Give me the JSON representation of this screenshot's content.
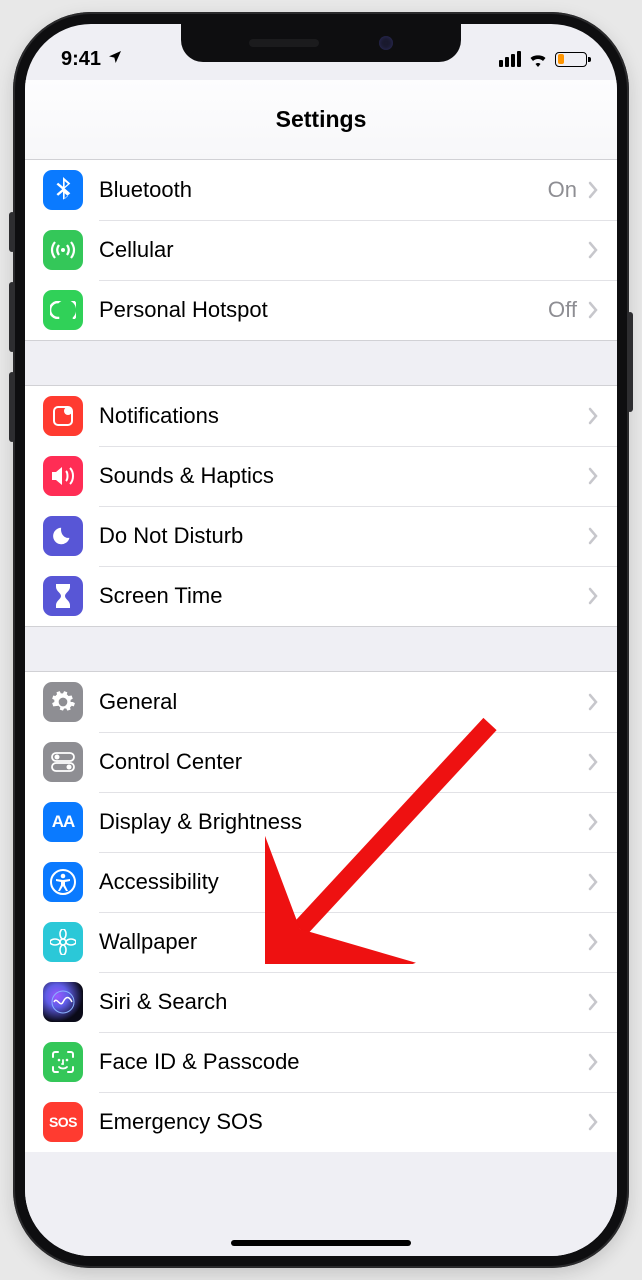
{
  "statusbar": {
    "time": "9:41"
  },
  "header": {
    "title": "Settings"
  },
  "groups": [
    {
      "rows": [
        {
          "name": "bluetooth",
          "label": "Bluetooth",
          "value": "On",
          "icon": "bluetooth-icon",
          "bg": "bg-blue"
        },
        {
          "name": "cellular",
          "label": "Cellular",
          "value": "",
          "icon": "cellular-icon",
          "bg": "bg-green"
        },
        {
          "name": "personal-hotspot",
          "label": "Personal Hotspot",
          "value": "Off",
          "icon": "hotspot-icon",
          "bg": "bg-green2"
        }
      ]
    },
    {
      "rows": [
        {
          "name": "notifications",
          "label": "Notifications",
          "value": "",
          "icon": "notifications-icon",
          "bg": "bg-red"
        },
        {
          "name": "sounds-haptics",
          "label": "Sounds & Haptics",
          "value": "",
          "icon": "sounds-icon",
          "bg": "bg-pink"
        },
        {
          "name": "do-not-disturb",
          "label": "Do Not Disturb",
          "value": "",
          "icon": "moon-icon",
          "bg": "bg-indigo"
        },
        {
          "name": "screen-time",
          "label": "Screen Time",
          "value": "",
          "icon": "hourglass-icon",
          "bg": "bg-indigo"
        }
      ]
    },
    {
      "rows": [
        {
          "name": "general",
          "label": "General",
          "value": "",
          "icon": "gear-icon",
          "bg": "bg-grey"
        },
        {
          "name": "control-center",
          "label": "Control Center",
          "value": "",
          "icon": "switches-icon",
          "bg": "bg-grey"
        },
        {
          "name": "display",
          "label": "Display & Brightness",
          "value": "",
          "icon": "text-size-icon",
          "bg": "bg-blue"
        },
        {
          "name": "accessibility",
          "label": "Accessibility",
          "value": "",
          "icon": "accessibility-icon",
          "bg": "bg-blue"
        },
        {
          "name": "wallpaper",
          "label": "Wallpaper",
          "value": "",
          "icon": "flower-icon",
          "bg": "bg-cyan"
        },
        {
          "name": "siri-search",
          "label": "Siri & Search",
          "value": "",
          "icon": "siri-icon",
          "bg": "bg-siri"
        },
        {
          "name": "faceid-passcode",
          "label": "Face ID & Passcode",
          "value": "",
          "icon": "faceid-icon",
          "bg": "bg-faceid"
        },
        {
          "name": "emergency-sos",
          "label": "Emergency SOS",
          "value": "",
          "icon": "sos-icon",
          "bg": "bg-sos"
        }
      ]
    }
  ],
  "annotation": {
    "points_to": "accessibility"
  }
}
